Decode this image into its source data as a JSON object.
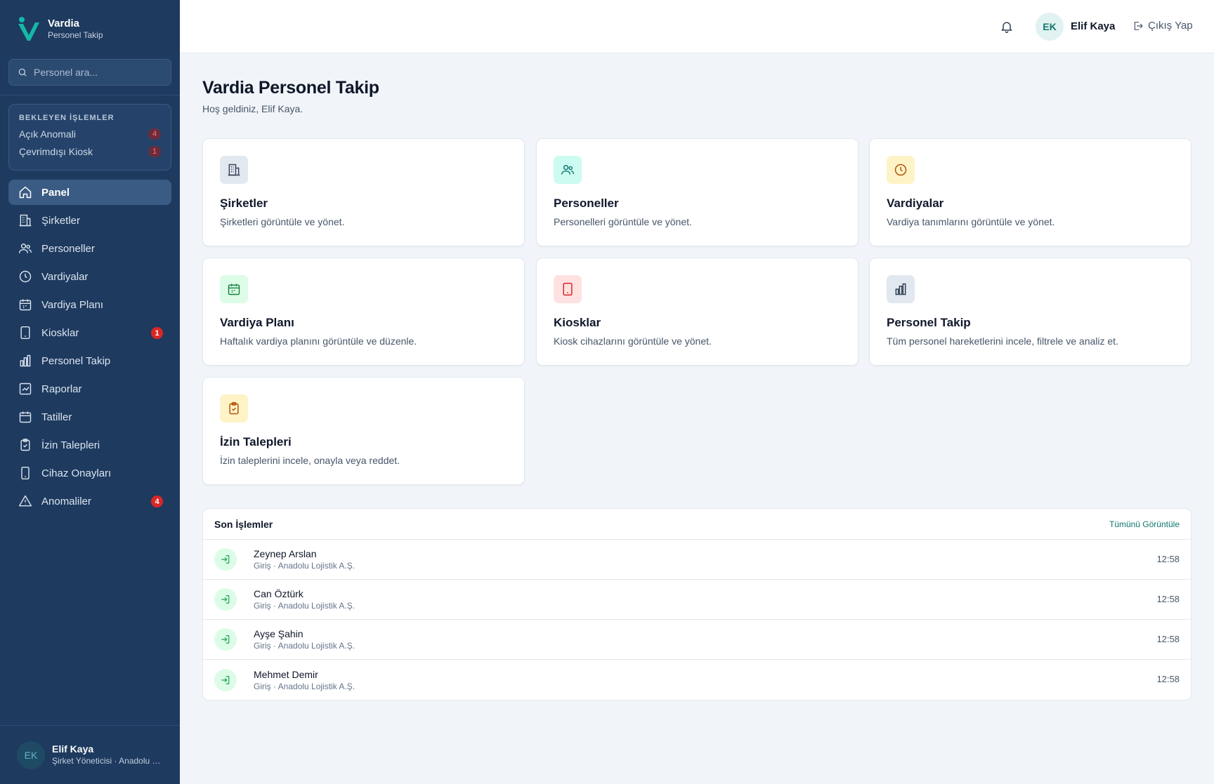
{
  "brand": {
    "title": "Vardia",
    "subtitle": "Personel Takip"
  },
  "search": {
    "placeholder": "Personel ara..."
  },
  "pending": {
    "title": "BEKLEYEN İŞLEMLER",
    "items": [
      {
        "label": "Açık Anomali",
        "count": "4"
      },
      {
        "label": "Çevrimdışı Kiosk",
        "count": "1"
      }
    ]
  },
  "nav": {
    "items": [
      {
        "label": "Panel",
        "icon": "home-icon",
        "active": true
      },
      {
        "label": "Şirketler",
        "icon": "building-icon"
      },
      {
        "label": "Personeller",
        "icon": "users-icon"
      },
      {
        "label": "Vardiyalar",
        "icon": "clock-icon"
      },
      {
        "label": "Vardiya Planı",
        "icon": "calendar-icon"
      },
      {
        "label": "Kiosklar",
        "icon": "tablet-icon",
        "badge": "1"
      },
      {
        "label": "Personel Takip",
        "icon": "bar-chart-icon"
      },
      {
        "label": "Raporlar",
        "icon": "report-icon"
      },
      {
        "label": "Tatiller",
        "icon": "calendar-icon"
      },
      {
        "label": "İzin Talepleri",
        "icon": "clipboard-check-icon"
      },
      {
        "label": "Cihaz Onayları",
        "icon": "smartphone-icon"
      },
      {
        "label": "Anomaliler",
        "icon": "alert-triangle-icon",
        "badge": "4"
      }
    ]
  },
  "sidebar_user": {
    "initials": "EK",
    "name": "Elif Kaya",
    "role": "Şirket Yöneticisi · Anadolu Lojistik A.Ş."
  },
  "topbar": {
    "initials": "EK",
    "name": "Elif Kaya",
    "logout": "Çıkış Yap"
  },
  "page": {
    "title": "Vardia Personel Takip",
    "subtitle": "Hoş geldiniz, Elif Kaya."
  },
  "cards": [
    {
      "title": "Şirketler",
      "desc": "Şirketleri görüntüle ve yönet.",
      "icon": "building-icon",
      "color": "#334155",
      "bg": "#e2e8f0"
    },
    {
      "title": "Personeller",
      "desc": "Personelleri görüntüle ve yönet.",
      "icon": "users-icon",
      "color": "#0f766e",
      "bg": "#ccfbf1"
    },
    {
      "title": "Vardiyalar",
      "desc": "Vardiya tanımlarını görüntüle ve yönet.",
      "icon": "clock-icon",
      "color": "#b45309",
      "bg": "#fef3c7"
    },
    {
      "title": "Vardiya Planı",
      "desc": "Haftalık vardiya planını görüntüle ve düzenle.",
      "icon": "calendar-icon",
      "color": "#15803d",
      "bg": "#dcfce7"
    },
    {
      "title": "Kiosklar",
      "desc": "Kiosk cihazlarını görüntüle ve yönet.",
      "icon": "tablet-icon",
      "color": "#dc2626",
      "bg": "#fee2e2"
    },
    {
      "title": "Personel Takip",
      "desc": "Tüm personel hareketlerini incele, filtrele ve analiz et.",
      "icon": "bar-chart-icon",
      "color": "#334155",
      "bg": "#e2e8f0"
    },
    {
      "title": "İzin Talepleri",
      "desc": "İzin taleplerini incele, onayla veya reddet.",
      "icon": "clipboard-check-icon",
      "color": "#b45309",
      "bg": "#fef3c7"
    }
  ],
  "activity": {
    "title": "Son İşlemler",
    "view_all": "Tümünü Görüntüle",
    "rows": [
      {
        "name": "Zeynep Arslan",
        "meta": "Giriş · Anadolu Lojistik A.Ş.",
        "time": "12:58"
      },
      {
        "name": "Can Öztürk",
        "meta": "Giriş · Anadolu Lojistik A.Ş.",
        "time": "12:58"
      },
      {
        "name": "Ayşe Şahin",
        "meta": "Giriş · Anadolu Lojistik A.Ş.",
        "time": "12:58"
      },
      {
        "name": "Mehmet Demir",
        "meta": "Giriş · Anadolu Lojistik A.Ş.",
        "time": "12:58"
      }
    ]
  },
  "colors": {
    "sidebar": "#1e3a5f",
    "accent": "#0f766e",
    "badge": "#dc2626",
    "logo": "#14b8a6"
  }
}
